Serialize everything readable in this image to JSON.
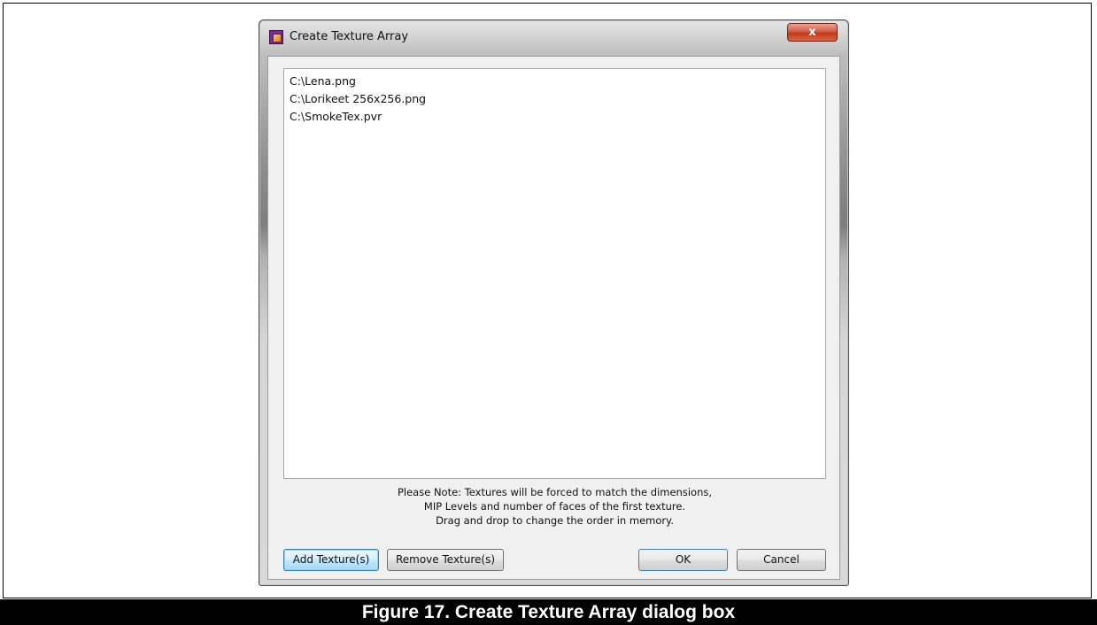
{
  "window": {
    "title": "Create Texture Array",
    "close_label": "x",
    "file_list": [
      "C:\\Lena.png",
      "C:\\Lorikeet 256x256.png",
      "C:\\SmokeTex.pvr"
    ],
    "note_lines": [
      "Please Note: Textures will be forced to match the dimensions,",
      "MIP Levels and number of faces of the first texture.",
      "Drag and drop to change the order in memory."
    ],
    "buttons": {
      "add": "Add Texture(s)",
      "remove": "Remove Texture(s)",
      "ok": "OK",
      "cancel": "Cancel"
    }
  },
  "caption": "Figure 17. Create Texture Array dialog box",
  "colors": {
    "caption_bg": "#000000",
    "caption_text": "#ffffff",
    "close_button": "#c8422a",
    "focus_accent": "#3c7fb1"
  },
  "icons": [
    "app-icon",
    "close-icon"
  ]
}
